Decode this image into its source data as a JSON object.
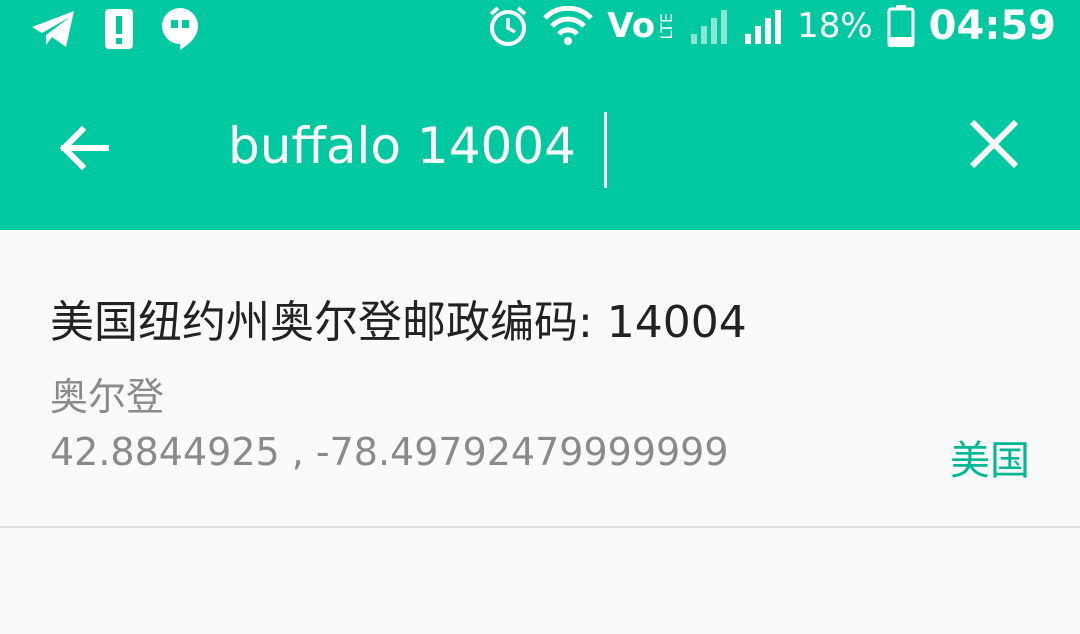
{
  "status_bar": {
    "battery_percent": "18%",
    "time": "04:59",
    "volte_label": "Vo",
    "lte_label": "LTE",
    "icons": [
      "telegram-icon",
      "alert-icon",
      "hangouts-icon",
      "alarm-icon",
      "wifi-icon",
      "volte-icon",
      "signal-icon",
      "signal-icon",
      "battery-icon"
    ]
  },
  "toolbar": {
    "search_value": "buffalo 14004",
    "back_icon": "arrow-left-icon",
    "clear_icon": "close-icon"
  },
  "results": [
    {
      "title": "美国纽约州奥尔登邮政编码: 14004",
      "city": "奥尔登",
      "coordinates": "42.8844925 , -78.49792479999999",
      "country": "美国"
    }
  ],
  "colors": {
    "accent": "#00c8a0",
    "country_text": "#00b894"
  }
}
